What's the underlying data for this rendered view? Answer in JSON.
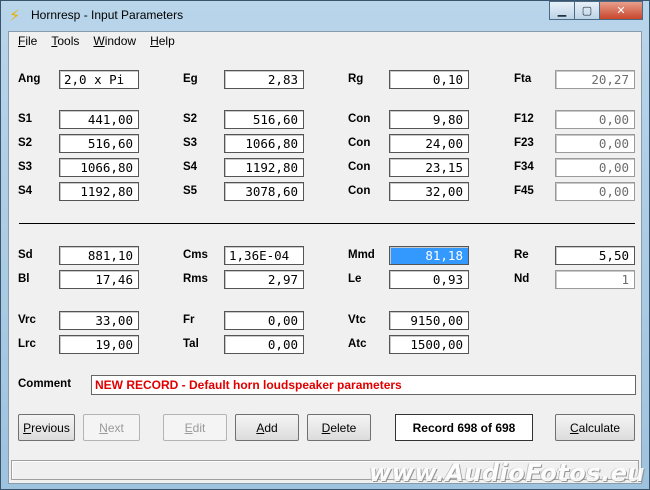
{
  "window": {
    "title": "Hornresp - Input Parameters"
  },
  "menu": [
    "File",
    "Tools",
    "Window",
    "Help"
  ],
  "row_top": {
    "Ang": "2,0 x Pi",
    "Eg": "2,83",
    "Rg": "0,10",
    "Fta": "20,27"
  },
  "sections": {
    "S1": "441,00",
    "S2a": "516,60",
    "Con1": "9,80",
    "F12": "0,00",
    "S2": "516,60",
    "S3a": "1066,80",
    "Con2": "24,00",
    "F23": "0,00",
    "S3": "1066,80",
    "S4a": "1192,80",
    "Con3": "23,15",
    "F34": "0,00",
    "S4": "1192,80",
    "S5": "3078,60",
    "Con4": "32,00",
    "F45": "0,00"
  },
  "driver": {
    "Sd": "881,10",
    "Cms": "1,36E-04",
    "Mmd": "81,18",
    "Re": "5,50",
    "Bl": "17,46",
    "Rms": "2,97",
    "Le": "0,93",
    "Nd": "1"
  },
  "chambers": {
    "Vrc": "33,00",
    "Fr": "0,00",
    "Vtc": "9150,00",
    "Lrc": "19,00",
    "Tal": "0,00",
    "Atc": "1500,00"
  },
  "labels": {
    "Ang": "Ang",
    "Eg": "Eg",
    "Rg": "Rg",
    "Fta": "Fta",
    "S1": "S1",
    "S2": "S2",
    "S3": "S3",
    "S4": "S4",
    "S5": "S5",
    "Con": "Con",
    "F12": "F12",
    "F23": "F23",
    "F34": "F34",
    "F45": "F45",
    "Sd": "Sd",
    "Cms": "Cms",
    "Mmd": "Mmd",
    "Re": "Re",
    "Bl": "Bl",
    "Rms": "Rms",
    "Le": "Le",
    "Nd": "Nd",
    "Vrc": "Vrc",
    "Fr": "Fr",
    "Vtc": "Vtc",
    "Lrc": "Lrc",
    "Tal": "Tal",
    "Atc": "Atc",
    "Comment": "Comment"
  },
  "comment": "NEW RECORD - Default horn loudspeaker parameters",
  "buttons": {
    "previous": "Previous",
    "next": "Next",
    "edit": "Edit",
    "add": "Add",
    "delete": "Delete",
    "calculate": "Calculate"
  },
  "record": "Record 698 of 698",
  "watermark": "www.AudioFotos.eu",
  "colors": {
    "comment_text": "#e00000",
    "selection": "#3399ff"
  }
}
